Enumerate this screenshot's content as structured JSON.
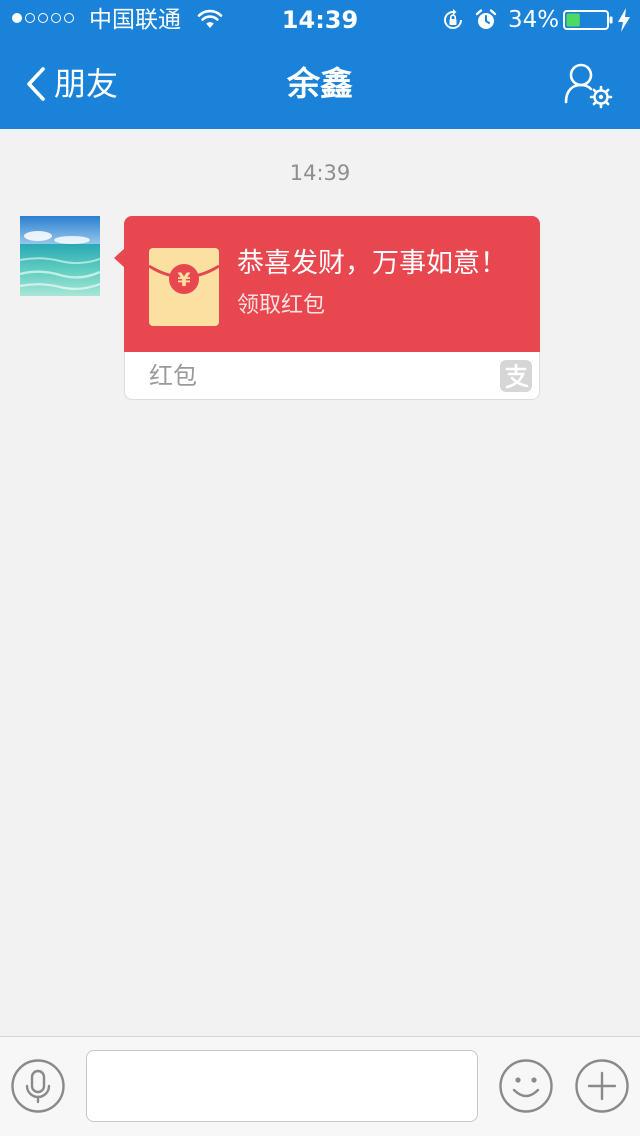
{
  "status_bar": {
    "carrier": "中国联通",
    "time": "14:39",
    "battery_percent": "34%",
    "battery_level": 0.34,
    "signal_strength": 1,
    "signal_max": 5,
    "charging": true
  },
  "nav": {
    "back_label": "朋友",
    "title": "余鑫",
    "right_icon": "profile-settings-icon"
  },
  "chat": {
    "timestamp": "14:39",
    "messages": [
      {
        "type": "red-packet",
        "greeting": "恭喜发财，万事如意！",
        "action": "领取红包",
        "label": "红包",
        "provider_icon": "alipay-icon"
      }
    ]
  },
  "input_bar": {
    "placeholder": "",
    "voice_icon": "microphone-icon",
    "emoji_icon": "smiley-icon",
    "more_icon": "plus-icon"
  },
  "colors": {
    "nav_background": "#1a82d8",
    "chat_background": "#f2f2f2",
    "packet_red": "#e8474f",
    "envelope_yellow": "#fbe0a1",
    "battery_green": "#4cd964"
  }
}
